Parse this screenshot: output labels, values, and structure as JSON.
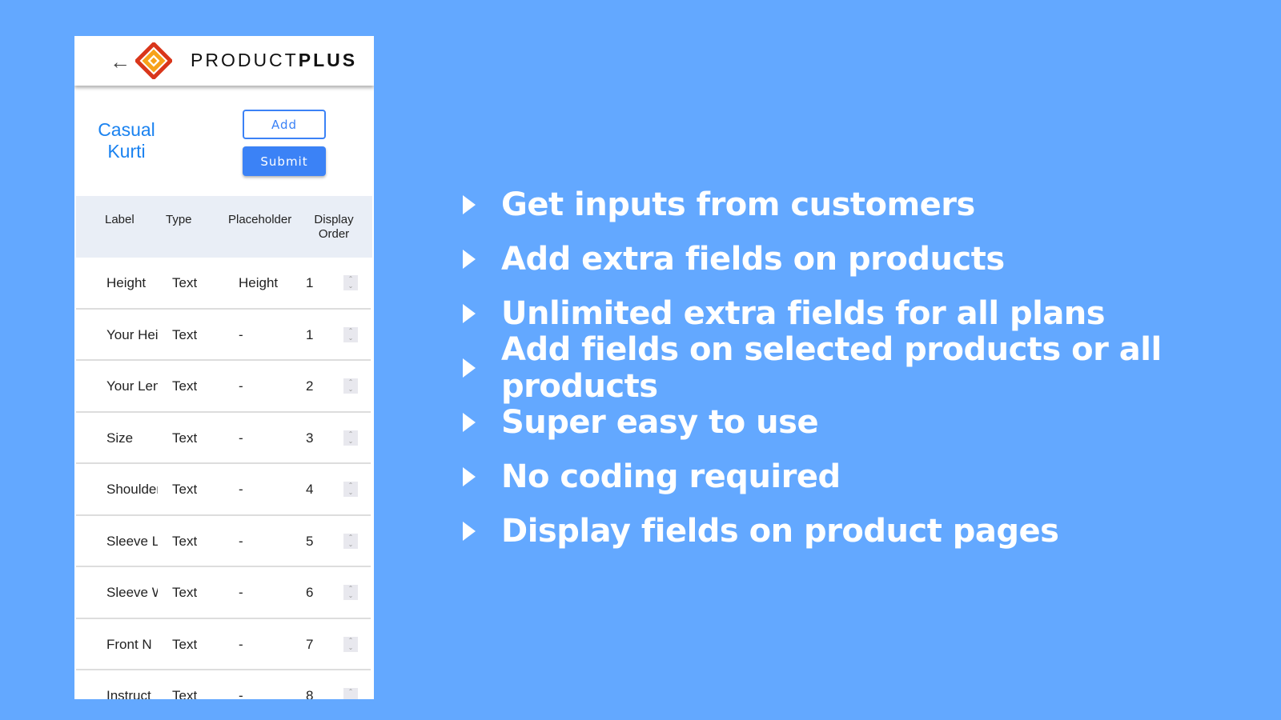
{
  "app": {
    "brand_light": "PRODUCT",
    "brand_bold": "PLUS",
    "back_icon": "arrow-left-icon"
  },
  "product": {
    "title": "Casual Kurti"
  },
  "buttons": {
    "add": "Add",
    "submit": "Submit"
  },
  "table": {
    "headers": [
      "Label",
      "Type",
      "Placeholder",
      "Display Order"
    ],
    "rows": [
      {
        "label": "Height",
        "type": "Text",
        "placeholder": "Height",
        "order": "1"
      },
      {
        "label": "Your Height",
        "type": "Text",
        "placeholder": "-",
        "order": "1"
      },
      {
        "label": "Your Length",
        "type": "Text",
        "placeholder": "-",
        "order": "2"
      },
      {
        "label": "Size",
        "type": "Text",
        "placeholder": "-",
        "order": "3"
      },
      {
        "label": "Shoulder",
        "type": "Text",
        "placeholder": "-",
        "order": "4"
      },
      {
        "label": "Sleeve L",
        "type": "Text",
        "placeholder": "-",
        "order": "5"
      },
      {
        "label": "Sleeve W",
        "type": "Text",
        "placeholder": "-",
        "order": "6"
      },
      {
        "label": "Front N",
        "type": "Text",
        "placeholder": "-",
        "order": "7"
      },
      {
        "label": "Instruct",
        "type": "Text",
        "placeholder": "-",
        "order": "8"
      }
    ]
  },
  "features": [
    "Get inputs from customers",
    "Add extra fields on products",
    "Unlimited extra fields for all plans",
    "Add fields on selected products or all products",
    "Super easy to use",
    "No coding required",
    "Display fields on product pages"
  ],
  "colors": {
    "background": "#63a8ff",
    "accent": "#3b82f6",
    "title": "#1a82f0"
  }
}
